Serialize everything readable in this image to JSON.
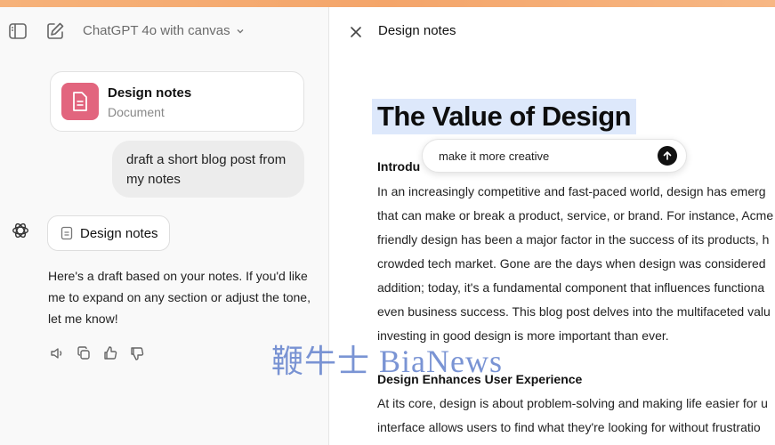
{
  "header": {
    "model_title": "ChatGPT 4o with canvas",
    "sidebar_icon": "sidebar-toggle-icon",
    "new_chat_icon": "new-chat-edit-icon",
    "accent": "#f4a56a"
  },
  "chat": {
    "doc_card": {
      "title": "Design notes",
      "subtitle": "Document",
      "tile_color": "#e2657e"
    },
    "user_message": "draft a short blog post from my notes",
    "assistant": {
      "doc_pill_label": "Design notes",
      "message": "Here's a draft based on your notes. If you'd like me to expand on any section or adjust the tone, let me know!",
      "actions": [
        "read-aloud-icon",
        "copy-icon",
        "thumbs-up-icon",
        "thumbs-down-icon"
      ]
    }
  },
  "canvas": {
    "title": "Design notes",
    "heading": "The Value of Design",
    "intro_heading": "Introdu",
    "intro_lines": [
      "In an increasingly competitive and fast-paced world, design has emerg",
      "that can make or break a product, service, or brand. For instance, Acme",
      "friendly design has been a major factor in the success of its products, h",
      "crowded tech market. Gone are the days when design was considered",
      "addition; today, it's a fundamental component that influences functiona",
      "even business success. This blog post delves into the multifaceted valu",
      "investing in good design is more important than ever."
    ],
    "section2_heading": "Design Enhances User Experience",
    "section2_lines": [
      "At its core, design is about problem-solving and making life easier for u",
      "interface allows users to find what they're looking for without frustratio"
    ],
    "prompt_value": "make it more creative",
    "highlight_color": "#dde8fb"
  },
  "watermark": "鞭牛士 BiaNews"
}
